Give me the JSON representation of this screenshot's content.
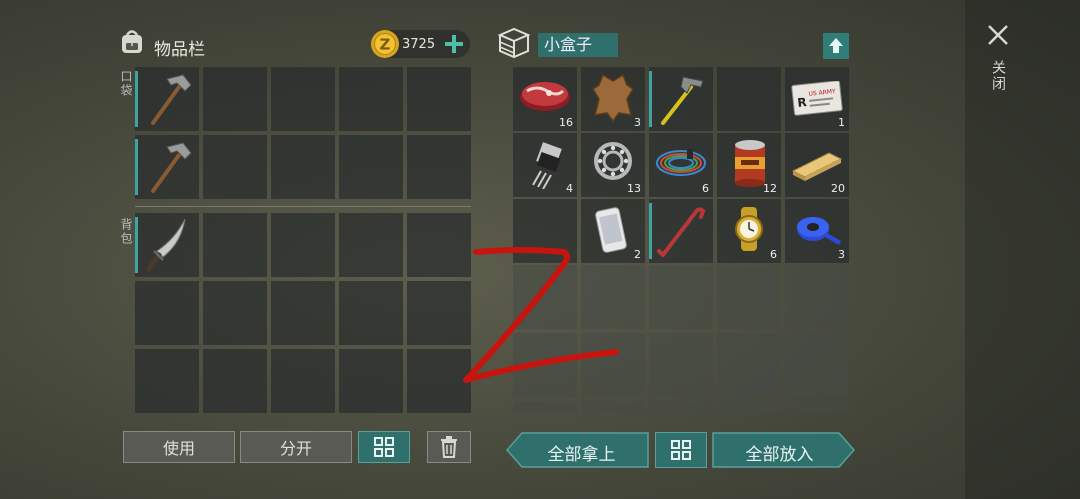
{
  "left": {
    "title": "物品栏",
    "currency": "3725",
    "currency_symbol": "Z",
    "pocket_label": "口袋",
    "backpack_label": "背包"
  },
  "right": {
    "title": "小盒子",
    "items": [
      {
        "icon": "meat-icon",
        "count": "16"
      },
      {
        "icon": "leather-icon",
        "count": "3"
      },
      {
        "icon": "hammer-icon",
        "count": ""
      },
      {
        "icon": "",
        "count": ""
      },
      {
        "icon": "id-card-icon",
        "count": "1"
      },
      {
        "icon": "transistor-icon",
        "count": "4"
      },
      {
        "icon": "bearing-icon",
        "count": "13"
      },
      {
        "icon": "wire-icon",
        "count": "6"
      },
      {
        "icon": "canned-food-icon",
        "count": "12"
      },
      {
        "icon": "plank-icon",
        "count": "20"
      },
      {
        "icon": "",
        "count": ""
      },
      {
        "icon": "smartphone-icon",
        "count": "2"
      },
      {
        "icon": "crowbar-icon",
        "count": ""
      },
      {
        "icon": "watch-icon",
        "count": "6"
      },
      {
        "icon": "tape-icon",
        "count": "3"
      }
    ],
    "id_card_text": "US ARMY"
  },
  "buttons": {
    "use": "使用",
    "split": "分开",
    "take_all": "全部拿上",
    "put_all": "全部放入"
  },
  "close": {
    "label": "关闭"
  },
  "annotation": "Z",
  "colors": {
    "accent_teal": "#3fa3a3",
    "currency_gold": "#d8a520",
    "annotation_red": "#c8140f"
  }
}
